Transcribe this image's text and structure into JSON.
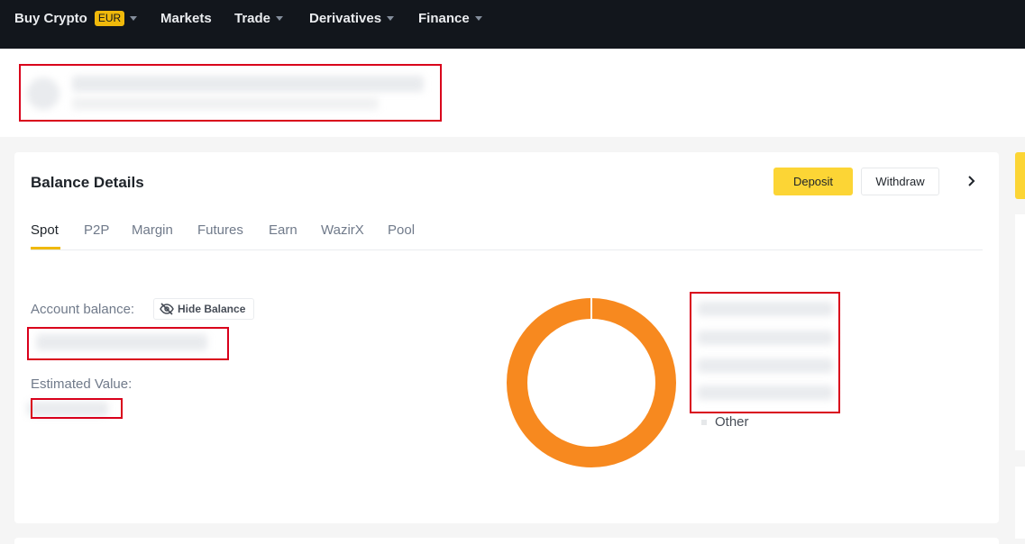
{
  "nav": {
    "items": [
      {
        "label": "Buy Crypto",
        "badge": "EUR",
        "has_caret": true
      },
      {
        "label": "Markets",
        "has_caret": false
      },
      {
        "label": "Trade",
        "has_caret": true
      },
      {
        "label": "Derivatives",
        "has_caret": true
      },
      {
        "label": "Finance",
        "has_caret": true
      }
    ]
  },
  "balance": {
    "title": "Balance Details",
    "deposit_label": "Deposit",
    "withdraw_label": "Withdraw",
    "tabs": [
      "Spot",
      "P2P",
      "Margin",
      "Futures",
      "Earn",
      "WazirX",
      "Pool"
    ],
    "active_tab": "Spot",
    "account_balance_label": "Account balance:",
    "hide_balance_label": "Hide Balance",
    "estimated_value_label": "Estimated Value:",
    "legend_other_label": "Other"
  },
  "colors": {
    "nav_bg": "#12161c",
    "accent": "#f0b90b",
    "deposit_bg": "#fcd535",
    "donut": "#f7891f",
    "redaction": "#d9001b"
  },
  "icons": {
    "eye_slash": "eye-slash-icon",
    "chevron_right": "chevron-right-icon",
    "caret_down": "caret-down-icon"
  }
}
